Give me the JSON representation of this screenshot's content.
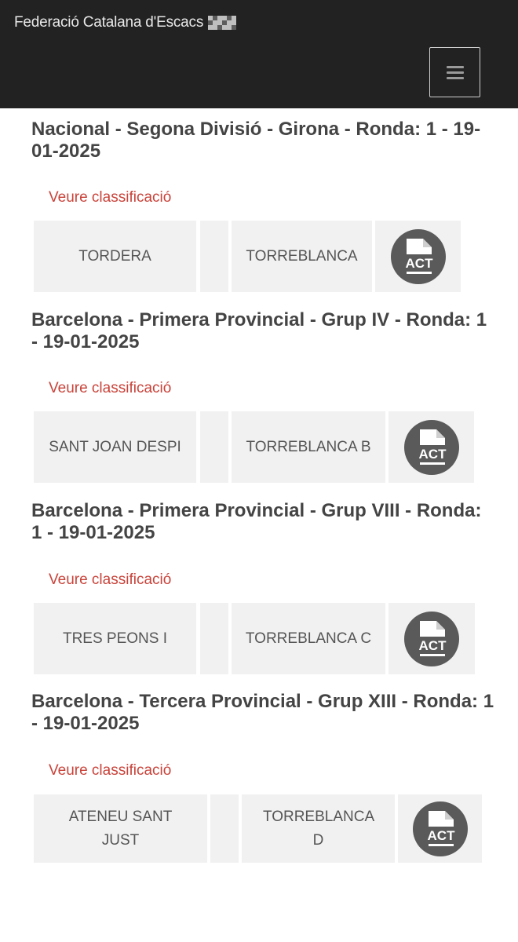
{
  "header": {
    "brand": "Federació Catalana d'Escacs",
    "menu_icon": "hamburger-menu-icon"
  },
  "colors": {
    "navbar": "#222222",
    "link": "#c9433a",
    "title": "#444444",
    "cell_bg": "#f1f1f1",
    "act_icon": "#5a5a5a"
  },
  "rounds": [
    {
      "title": "Nacional - Segona Divisió - Girona - Ronda: 1 - 19-01-2025",
      "link": "Veure classificació",
      "home": "TORDERA",
      "score": "",
      "away": "TORREBLANCA",
      "act_icon": "act-document-icon",
      "act_label": "ACT"
    },
    {
      "title": "Barcelona - Primera Provincial - Grup IV - Ronda: 1 - 19-01-2025",
      "link": "Veure classificació",
      "home": "SANT JOAN DESPI",
      "score": "",
      "away": "TORREBLANCA B",
      "act_icon": "act-document-icon",
      "act_label": "ACT"
    },
    {
      "title": "Barcelona - Primera Provincial - Grup VIII - Ronda: 1 - 19-01-2025",
      "link": "Veure classificació",
      "home": "TRES PEONS I",
      "score": "",
      "away": "TORREBLANCA C",
      "act_icon": "act-document-icon",
      "act_label": "ACT"
    },
    {
      "title": "Barcelona - Tercera Provincial - Grup XIII - Ronda: 1 - 19-01-2025",
      "link": "Veure classificació",
      "home": "ATENEU SANT JUST",
      "score": "",
      "away": "TORREBLANCA D",
      "act_icon": "act-document-icon",
      "act_label": "ACT"
    }
  ]
}
